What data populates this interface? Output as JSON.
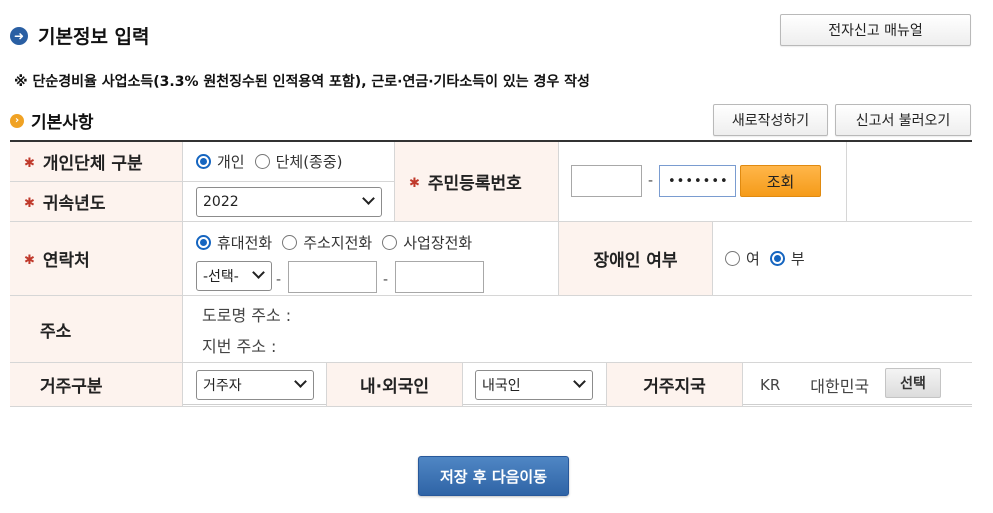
{
  "header": {
    "title": "기본정보 입력",
    "manual_button": "전자신고 매뉴얼",
    "notice": "※ 단순경비율 사업소득(3.3% 원천징수된 인적용역 포함), 근로·연금·기타소득이 있는 경우 작성"
  },
  "section": {
    "title": "기본사항",
    "new_button": "새로작성하기",
    "load_button": "신고서 불러오기"
  },
  "form": {
    "entity_type": {
      "label": "개인단체 구분",
      "options": [
        "개인",
        "단체(종중)"
      ],
      "selected": "개인"
    },
    "year": {
      "label": "귀속년도",
      "value": "2022"
    },
    "rrn": {
      "label": "주민등록번호",
      "front": "",
      "back": "•••••••",
      "separator": "-",
      "lookup_button": "조회"
    },
    "contact": {
      "label": "연락처",
      "options": [
        "휴대전화",
        "주소지전화",
        "사업장전화"
      ],
      "selected": "휴대전화",
      "prefix_select": "-선택-",
      "separator": "-",
      "middle": "",
      "last": ""
    },
    "disability": {
      "label": "장애인 여부",
      "options": [
        "여",
        "부"
      ],
      "selected": "부"
    },
    "address": {
      "label": "주소",
      "road": "도로명 주소 :",
      "lot": "지번 주소 :"
    },
    "residence": {
      "label": "거주구분",
      "value": "거주자"
    },
    "nationality": {
      "label": "내·외국인",
      "value": "내국인"
    },
    "country": {
      "label": "거주지국",
      "code": "KR",
      "name": "대한민국",
      "select_button": "선택"
    }
  },
  "footer": {
    "save_button": "저장 후 다음이동"
  },
  "colors": {
    "label_bg": "#fdf3ee",
    "primary": "#2f64a6",
    "accent": "#f59b19",
    "required": "#c0392b"
  }
}
